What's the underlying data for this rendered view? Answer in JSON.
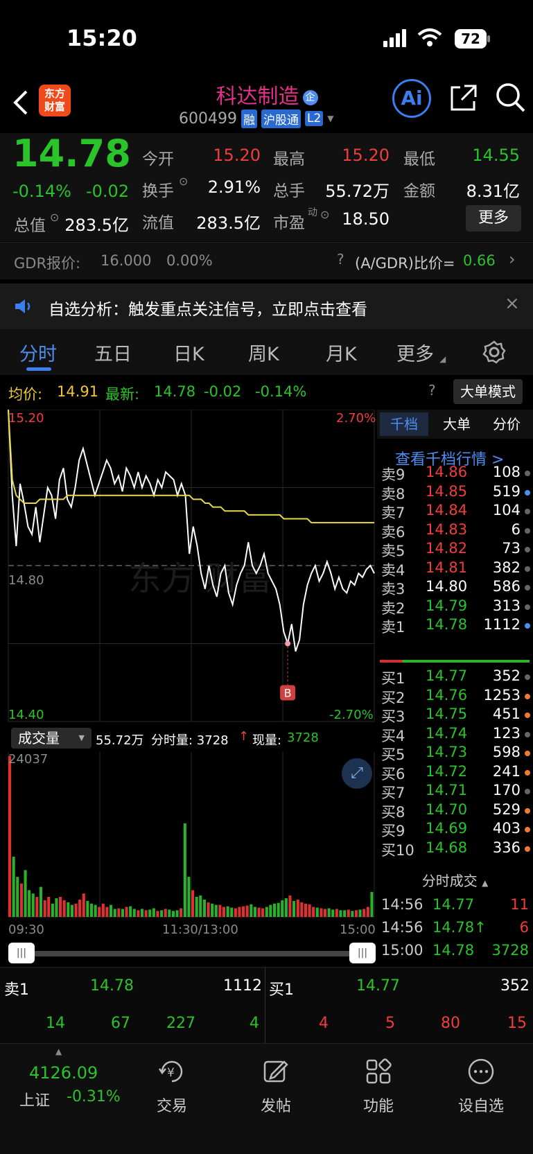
{
  "status": {
    "time": "15:20",
    "battery": "72"
  },
  "header": {
    "name": "科达制造",
    "tag_qi": "企",
    "code": "600499",
    "badges": [
      "融",
      "沪股通",
      "L2"
    ],
    "logo_text": "东方\n财富",
    "ai_label": "Ai"
  },
  "quote": {
    "price": "14.78",
    "change_pct": "-0.14%",
    "change": "-0.02",
    "open_label": "今开",
    "open": "15.20",
    "high_label": "最高",
    "high": "15.20",
    "low_label": "最低",
    "low": "14.55",
    "turnover_label": "换手",
    "turnover": "2.91%",
    "volume_label": "总手",
    "volume": "55.72万",
    "amount_label": "金额",
    "amount": "8.31亿",
    "mktcap_label": "总值",
    "mktcap": "283.5亿",
    "float_label": "流值",
    "float": "283.5亿",
    "pe_label": "市盈",
    "pe_sup": "动",
    "pe": "18.50",
    "more_button": "更多"
  },
  "gdr": {
    "label": "GDR报价:",
    "price": "16.000",
    "pct": "0.00%",
    "ratio_label": "(A/GDR)比价=",
    "ratio": "0.66"
  },
  "notice": {
    "text": "自选分析：触发重点关注信号，立即点击查看"
  },
  "tabs": [
    "分时",
    "五日",
    "日K",
    "周K",
    "月K",
    "更多"
  ],
  "avgbar": {
    "avg_label": "均价:",
    "avg": "14.91",
    "latest_label": "最新:",
    "latest": "14.78",
    "chg": "-0.02",
    "pct": "-0.14%",
    "mode_button": "大单模式"
  },
  "chart_labels": {
    "top_price": "15.20",
    "top_pct": "2.70%",
    "mid_price": "14.80",
    "bot_price": "14.40",
    "bot_pct": "-2.70%",
    "marker": "B",
    "vol_selector": "成交量",
    "vol_total": "55.72万",
    "vol_minute": "分时量: 3728",
    "vol_now_label": "现量:",
    "vol_now": "3728",
    "vol_max": "24037",
    "t_start": "09:30",
    "t_mid": "11:30/13:00",
    "t_end": "15:00"
  },
  "book": {
    "tabs": [
      "千档",
      "大单",
      "分价"
    ],
    "link": "查看千档行情 >",
    "asks": [
      {
        "label": "卖9",
        "price": "14.86",
        "vol": "108",
        "dot": "#666"
      },
      {
        "label": "卖8",
        "price": "14.85",
        "vol": "519",
        "dot": "#4f8df0"
      },
      {
        "label": "卖7",
        "price": "14.84",
        "vol": "104",
        "dot": "#666"
      },
      {
        "label": "卖6",
        "price": "14.83",
        "vol": "6",
        "dot": "#666"
      },
      {
        "label": "卖5",
        "price": "14.82",
        "vol": "73",
        "dot": "#666"
      },
      {
        "label": "卖4",
        "price": "14.81",
        "vol": "382",
        "dot": "#666"
      },
      {
        "label": "卖3",
        "price": "14.80",
        "vol": "586",
        "dot": "#666"
      },
      {
        "label": "卖2",
        "price": "14.79",
        "vol": "313",
        "dot": "#666"
      },
      {
        "label": "卖1",
        "price": "14.78",
        "vol": "1112",
        "dot": "#4f8df0"
      }
    ],
    "bids": [
      {
        "label": "买1",
        "price": "14.77",
        "vol": "352",
        "dot": "#666"
      },
      {
        "label": "买2",
        "price": "14.76",
        "vol": "1253",
        "dot": "#f07a30"
      },
      {
        "label": "买3",
        "price": "14.75",
        "vol": "451",
        "dot": "#f07a30"
      },
      {
        "label": "买4",
        "price": "14.74",
        "vol": "123",
        "dot": "#666"
      },
      {
        "label": "买5",
        "price": "14.73",
        "vol": "598",
        "dot": "#f07a30"
      },
      {
        "label": "买6",
        "price": "14.72",
        "vol": "241",
        "dot": "#f07a30"
      },
      {
        "label": "买7",
        "price": "14.71",
        "vol": "170",
        "dot": "#666"
      },
      {
        "label": "买8",
        "price": "14.70",
        "vol": "529",
        "dot": "#f07a30"
      },
      {
        "label": "买9",
        "price": "14.69",
        "vol": "403",
        "dot": "#f07a30"
      },
      {
        "label": "买10",
        "price": "14.68",
        "vol": "336",
        "dot": "#f07a30"
      }
    ],
    "ticks_title": "分时成交",
    "ticks": [
      {
        "time": "14:56",
        "price": "14.77",
        "vol": "11"
      },
      {
        "time": "14:56",
        "price": "14.78↑",
        "vol": "6"
      },
      {
        "time": "15:00",
        "price": "14.78",
        "vol": "3728"
      }
    ]
  },
  "bidask": {
    "sell_label": "卖1",
    "sell_price": "14.78",
    "sell_vol": "1112",
    "buy_label": "买1",
    "buy_price": "14.77",
    "buy_vol": "352",
    "sell_row": [
      "14",
      "67",
      "227",
      "4"
    ],
    "buy_row": [
      "4",
      "5",
      "80",
      "15"
    ]
  },
  "bottom": {
    "index_value": "4126.09",
    "index_name": "上证",
    "index_pct": "-0.31%",
    "nav": [
      "交易",
      "发帖",
      "功能",
      "设自选"
    ]
  },
  "chart_data": {
    "type": "line",
    "price_range": [
      14.4,
      15.2
    ],
    "prev_close": 14.8,
    "price_series": [
      15.2,
      14.98,
      14.85,
      15.01,
      14.96,
      14.9,
      14.88,
      14.95,
      14.86,
      14.93,
      15.0,
      14.98,
      14.92,
      15.02,
      15.05,
      14.97,
      14.95,
      15.0,
      15.07,
      15.1,
      15.06,
      15.02,
      14.98,
      15.01,
      15.04,
      15.07,
      15.05,
      15.01,
      15.03,
      14.99,
      15.05,
      15.03,
      15.0,
      15.04,
      15.0,
      15.03,
      15.01,
      14.98,
      15.02,
      15.0,
      15.04,
      15.03,
      15.02,
      14.98,
      15.01,
      14.98,
      14.83,
      14.9,
      14.85,
      14.78,
      14.74,
      14.8,
      14.75,
      14.72,
      14.78,
      14.8,
      14.73,
      14.7,
      14.75,
      14.78,
      14.8,
      14.86,
      14.8,
      14.78,
      14.8,
      14.83,
      14.78,
      14.76,
      14.74,
      14.7,
      14.63,
      14.6,
      14.65,
      14.58,
      14.61,
      14.7,
      14.75,
      14.78,
      14.8,
      14.76,
      14.78,
      14.81,
      14.78,
      14.74,
      14.77,
      14.74,
      14.73,
      14.76,
      14.75,
      14.78,
      14.77,
      14.79,
      14.8,
      14.78
    ],
    "avg_series": [
      15.2,
      15.02,
      14.98,
      14.97,
      14.96,
      14.96,
      14.96,
      14.96,
      14.97,
      14.97,
      14.97,
      14.97,
      14.97,
      14.97,
      14.97,
      14.98,
      14.98,
      14.98,
      14.98,
      14.98,
      14.98,
      14.98,
      14.98,
      14.98,
      14.98,
      14.98,
      14.98,
      14.98,
      14.98,
      14.98,
      14.98,
      14.98,
      14.98,
      14.98,
      14.98,
      14.98,
      14.98,
      14.98,
      14.98,
      14.98,
      14.98,
      14.98,
      14.98,
      14.98,
      14.98,
      14.98,
      14.98,
      14.97,
      14.97,
      14.97,
      14.96,
      14.96,
      14.95,
      14.95,
      14.95,
      14.94,
      14.94,
      14.94,
      14.94,
      14.94,
      14.94,
      14.93,
      14.93,
      14.93,
      14.93,
      14.93,
      14.93,
      14.93,
      14.93,
      14.93,
      14.92,
      14.92,
      14.92,
      14.92,
      14.92,
      14.92,
      14.92,
      14.91,
      14.91,
      14.91,
      14.91,
      14.91,
      14.91,
      14.91,
      14.91,
      14.91,
      14.91,
      14.91,
      14.91,
      14.91,
      14.91,
      14.91,
      14.91,
      14.91
    ],
    "volume_series": [
      24037,
      9000,
      6000,
      5000,
      7000,
      4000,
      3500,
      3000,
      4500,
      2500,
      3000,
      2000,
      2800,
      3000,
      2500,
      2200,
      1800,
      2000,
      2600,
      3500,
      2400,
      2000,
      1800,
      1500,
      2000,
      1500,
      1800,
      1200,
      1300,
      1200,
      1500,
      1600,
      1200,
      1000,
      1200,
      1000,
      1100,
      1300,
      900,
      1000,
      1200,
      1100,
      900,
      1000,
      1300,
      14000,
      6000,
      4000,
      3000,
      3200,
      2600,
      2200,
      2000,
      1800,
      1800,
      1500,
      1600,
      1400,
      1300,
      1500,
      1600,
      1700,
      1900,
      1500,
      1400,
      1300,
      1500,
      1800,
      2000,
      2100,
      2500,
      2800,
      3200,
      2400,
      2600,
      2200,
      2000,
      1900,
      1500,
      1400,
      1300,
      1200,
      1300,
      1100,
      1200,
      1000,
      1000,
      1100,
      900,
      1000,
      1100,
      1200,
      1500,
      3728
    ],
    "marker_index": 71
  }
}
